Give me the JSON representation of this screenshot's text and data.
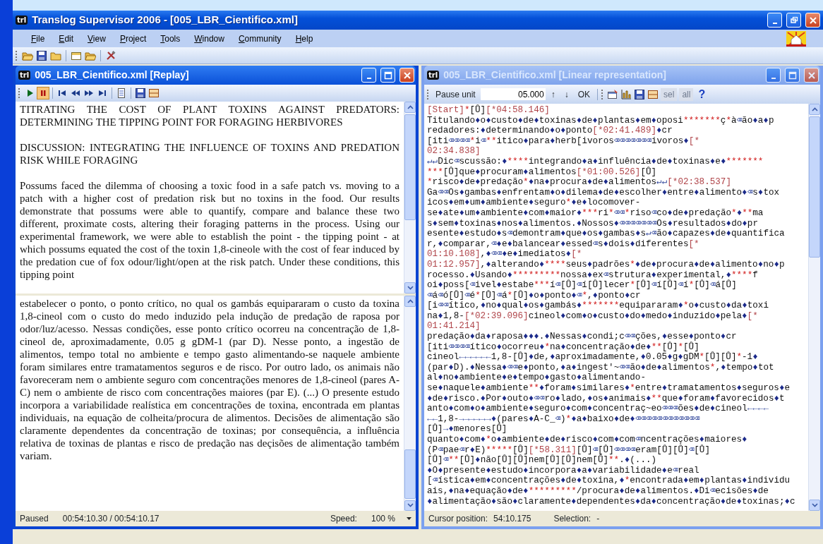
{
  "app": {
    "logo": "trl",
    "title": "Translog Supervisor 2006 - [005_LBR_Cientifico.xml]"
  },
  "menu": [
    {
      "label": "File"
    },
    {
      "label": "Edit"
    },
    {
      "label": "View"
    },
    {
      "label": "Project"
    },
    {
      "label": "Tools"
    },
    {
      "label": "Window"
    },
    {
      "label": "Community"
    },
    {
      "label": "Help"
    }
  ],
  "toolbar": [
    {
      "kind": "open"
    },
    {
      "kind": "save"
    },
    {
      "kind": "folder"
    },
    {
      "kind": "sep"
    },
    {
      "kind": "window"
    },
    {
      "kind": "open"
    },
    {
      "kind": "sep"
    },
    {
      "kind": "tools"
    }
  ],
  "replay": {
    "logo": "trl",
    "title": "005_LBR_Cientifico.xml [Replay]",
    "active": true,
    "controls": [
      {
        "kind": "play",
        "selected": false
      },
      {
        "kind": "pause",
        "selected": true
      },
      {
        "kind": "sep"
      },
      {
        "kind": "skip-start",
        "selected": false
      },
      {
        "kind": "rewind",
        "selected": false
      },
      {
        "kind": "forward",
        "selected": false
      },
      {
        "kind": "skip-end",
        "selected": false
      },
      {
        "kind": "sep"
      },
      {
        "kind": "document",
        "selected": false
      },
      {
        "kind": "sep"
      },
      {
        "kind": "save",
        "selected": false
      },
      {
        "kind": "panel",
        "selected": false
      }
    ],
    "source": [
      {
        "text": "TITRATING THE COST OF PLANT TOXINS AGAINST PREDATORS: DETERMINING THE TIPPING POINT FOR FORAGING HERBIVORES"
      },
      {
        "text": "DISCUSSION: INTEGRATING THE INFLUENCE OF TOXINS AND PREDATION RISK WHILE FORAGING"
      },
      {
        "text": "Possums faced the dilemma of choosing a toxic food in a safe patch vs. moving to a patch with a higher cost of predation risk but no toxins in the food. Our results demonstrate that possums were able to quantify, compare and balance these two different, proximate costs, altering their foraging patterns in the process. Using our experimental framework, we were able to establish the point - the tipping point - at which possums equated the cost of the toxin 1,8-cineole with the cost of fear induced by the predation cue of fox odour/light/open at the risk patch. Under these conditions, this tipping point"
      }
    ],
    "target": "estabelecer o ponto, o ponto crítico, no qual os gambás equipararam o custo da toxina 1,8-cineol com o custo do medo induzido pela indução de predação de raposa por odor/luz/acesso. Nessas condições, esse ponto crítico ocorreu na concentração de 1,8-cineol de, aproximadamente, 0.05 g gDM-1 (par D). Nesse ponto, a ingestão de alimentos, tempo total no ambiente e tempo gasto alimentando-se naquele ambiente foram similares entre tramatamentos seguros e de risco. Por outro lado, os animais não favoreceram nem o ambiente seguro com concentrações menores de 1,8-cineol (pares A-C) nem o ambiente de risco com concentrações maiores (par E). (...) O presente estudo incorpora a variabilidade realística em concentrações de toxina, encontrada em plantas individuais, na equação de colheita/procura de alimentos. Decisões de alimentação são claramente dependentes da concentração de toxinas; por consequência, a influência relativa de toxinas de plantas e risco de predação nas deçisões de alimentação também variam.",
    "status": {
      "state": "Paused",
      "time": "00:54:10.30 / 00:54:10.17",
      "speed_label": "Speed:",
      "speed": "100 %"
    }
  },
  "linear": {
    "logo": "trl",
    "title": "005_LBR_Cientifico.xml [Linear representation]",
    "active": false,
    "pause_label": "Pause unit",
    "pause_value": "05.000",
    "up": "↑",
    "down": "↓",
    "ok": "OK",
    "tools": [
      {
        "kind": "properties",
        "disabled": false
      },
      {
        "kind": "chart",
        "disabled": false
      },
      {
        "kind": "save",
        "disabled": false
      },
      {
        "kind": "panel",
        "disabled": false
      },
      {
        "kind": "text",
        "label": "sel",
        "disabled": true
      },
      {
        "kind": "text",
        "label": "all",
        "disabled": true
      },
      {
        "kind": "help",
        "label": "?",
        "disabled": false
      }
    ],
    "lines": [
      [
        {
          "kind": "time",
          "text": "[Start]"
        },
        {
          "kind": "keys",
          "text": "*[Ů]"
        },
        {
          "kind": "time",
          "text": "[*04:58.146]"
        }
      ],
      [
        {
          "kind": "keys",
          "text": "Titulando♦o♦custo♦de♦toxinas♦de♦plantas♦em♦oposi*******ç*à⌫ão♦a♦p"
        }
      ],
      [
        {
          "kind": "keys",
          "text": "redadores:♦determinando♦o♦ponto"
        },
        {
          "kind": "time",
          "text": "[*02:41.489]"
        },
        {
          "kind": "keys",
          "text": "♦cr"
        }
      ],
      [
        {
          "kind": "keys",
          "text": "[iti⌫⌫⌫⌫*i⌫**itico♦para♦herb[ivoros⌫⌫⌫⌫⌫⌫⌫ivoros♦"
        },
        {
          "kind": "time",
          "text": "[*"
        }
      ],
      [
        {
          "kind": "time",
          "text": "02:34.838]"
        }
      ],
      [
        {
          "kind": "keys",
          "text": "↵↵Dic⌫scussão:♦****integrando♦a♦influência♦de♦toxinas♦e♦*******"
        }
      ],
      [
        {
          "kind": "keys",
          "text": "***[Ů]que♦procuram♦alimentos"
        },
        {
          "kind": "time",
          "text": "[*01:00.526]"
        },
        {
          "kind": "keys",
          "text": "[Ů]"
        }
      ],
      [
        {
          "kind": "keys",
          "text": "*risco♦de♦predação*♦na♦procura♦de♦alimentos↵↵"
        },
        {
          "kind": "time",
          "text": "[*02:38.537]"
        }
      ],
      [
        {
          "kind": "keys",
          "text": "Ga⌫⌫Os♦gambas♦enfrentam♦o♦dilema♦de♦escolher♦entre♦alimento♦⌫s♦tox"
        }
      ],
      [
        {
          "kind": "keys",
          "text": "icos♦em♦um♦ambiente♦seguro*♦e♦locomover-"
        }
      ],
      [
        {
          "kind": "keys",
          "text": "se♦ate♦um♦ambiente♦com♦maior♦***ri*⌫⌫*riso⌫co♦de♦predação*♦**ma"
        }
      ],
      [
        {
          "kind": "keys",
          "text": "s♦sem♦toxinas♦nos♦alimentos.♦Nossos♦⌫⌫⌫⌫⌫⌫⌫Os♦resultados♦do♦pr"
        }
      ],
      [
        {
          "kind": "keys",
          "text": "esente♦estudo♦s⌫demontram♦que♦os♦gambas♦s↵⌫ão♦capazes♦de♦quantifica"
        }
      ],
      [
        {
          "kind": "keys",
          "text": "r,♦comparar,⌫♦e♦balancear♦essed⌫s♦dois♦diferentes"
        },
        {
          "kind": "time",
          "text": "[*"
        }
      ],
      [
        {
          "kind": "time",
          "text": "01:10.108]"
        },
        {
          "kind": "keys",
          "text": ",♦⌫⌫♦e♦imediatos♦"
        },
        {
          "kind": "time",
          "text": "[*"
        }
      ],
      [
        {
          "kind": "time",
          "text": "01:12.957]"
        },
        {
          "kind": "keys",
          "text": ",♦alterando♦****seus♦padrões*♦de♦procura♦de♦alimento♦no♦p"
        }
      ],
      [
        {
          "kind": "keys",
          "text": "rocesso.♦Usando♦*********nossa♦ex⌫strutura♦experimental,♦****f"
        }
      ],
      [
        {
          "kind": "keys",
          "text": "oi♦poss[⌫ivel♦estabe***í⌫[Ů]⌫í[Ů]lecer*[Ů]⌫í[Ů]⌫í*[Ů]⌫á[Ů]"
        }
      ],
      [
        {
          "kind": "keys",
          "text": "⌫á⌫ó[Ů]⌫é*[Ů]⌫á*[Ů]♦o♦ponto♦⌫*,♦ponto♦cr"
        }
      ],
      [
        {
          "kind": "keys",
          "text": "[i⌫⌫ítico,♦no♦qual♦os♦gambás♦*******equipararam♦*o♦custo♦da♦toxi"
        }
      ],
      [
        {
          "kind": "keys",
          "text": "na♦1,8-"
        },
        {
          "kind": "time",
          "text": "[*02:39.096]"
        },
        {
          "kind": "keys",
          "text": "cineol♦com♦o♦custo♦do♦medo♦induzido♦pela♦"
        },
        {
          "kind": "time",
          "text": "[*"
        }
      ],
      [
        {
          "kind": "time",
          "text": "01:41.214]"
        }
      ],
      [
        {
          "kind": "keys",
          "text": "predação♦da♦raposa♦♦♦.♦Nessas♦condi;c⌫⌫ções,♦esse♦ponto♦cr"
        }
      ],
      [
        {
          "kind": "keys",
          "text": "[iti⌫⌫⌫⌫ítico♦ocorreu♦*na♦concentração♦de♦**[Ů]*[Ů]"
        }
      ],
      [
        {
          "kind": "keys",
          "text": "cineol←←←←←←1,8-[Ů]♦de,♦aproximadamente,♦0.05♦g♦gDM*[Ů][Ů]*-1♦"
        }
      ],
      [
        {
          "kind": "keys",
          "text": "(par♦D).♦Nessa♦⌫⌫e♦ponto,♦a♦ingest'~⌫⌫ão♦de♦alimentos*,♦tempo♦tot"
        }
      ],
      [
        {
          "kind": "keys",
          "text": "al♦no♦ambiente♦e♦tempo♦gasto♦alimentando-"
        }
      ],
      [
        {
          "kind": "keys",
          "text": "se♦naquele♦ambiente**♦foram♦similares♦*entre♦tramatamentos♦seguros♦e"
        }
      ],
      [
        {
          "kind": "keys",
          "text": "♦de♦risco.♦Por♦outo♦⌫⌫ro♦lado,♦os♦animais♦**que♦foram♦favorecidos♦t"
        }
      ],
      [
        {
          "kind": "keys",
          "text": "anto♦com♦o♦ambiente♦seguro♦com♦concentraç~eo⌫⌫⌫ões♦de♦cineol←←←←"
        }
      ],
      [
        {
          "kind": "keys",
          "text": "←←1,8-→→→→→→♦(pares♦A-C_⌫)*♦a♦baixo♦de♦⌫⌫⌫⌫⌫⌫⌫⌫⌫⌫⌫⌫"
        }
      ],
      [
        {
          "kind": "keys",
          "text": "[Ů]→♦menores[Ů]"
        }
      ],
      [
        {
          "kind": "keys",
          "text": "quanto♦com♦*o♦ambiente♦de♦risco♦com♦com⌫ncentrações♦maiores♦"
        }
      ],
      [
        {
          "kind": "keys",
          "text": "(P⌫pae⌫r♦E)*****[Ů]"
        },
        {
          "kind": "time",
          "text": "[*58.311]"
        },
        {
          "kind": "keys",
          "text": "[Ů]⌫[Ů]⌫⌫⌫⌫eram[Ů][Ů]⌫[Ů]"
        }
      ],
      [
        {
          "kind": "keys",
          "text": "[Ů]⌫**[Ů]♦não[Ů][Ů]nem[Ů][Ů]nem[Ů]**.♦(...)"
        }
      ],
      [
        {
          "kind": "keys",
          "text": "♦O♦presente♦estudo♦incorpora♦a♦variabilidade♦e⌫real"
        }
      ],
      [
        {
          "kind": "keys",
          "text": "[⌫ística♦em♦concentrações♦de♦toxina,♦*encontrada♦em♦plantas♦individu"
        }
      ],
      [
        {
          "kind": "keys",
          "text": "ais,♦na♦equação♦de♦*********/procura♦de♦alimentos.♦Di⌫ecisões♦de"
        }
      ],
      [
        {
          "kind": "keys",
          "text": "♦alimentação♦são♦claramente♦dependentes♦da♦concentração♦de♦toxinas;♦c"
        }
      ]
    ],
    "status": {
      "cursor_label": "Cursor position:",
      "cursor": "54:10.175",
      "selection_label": "Selection:",
      "selection": "-"
    }
  }
}
